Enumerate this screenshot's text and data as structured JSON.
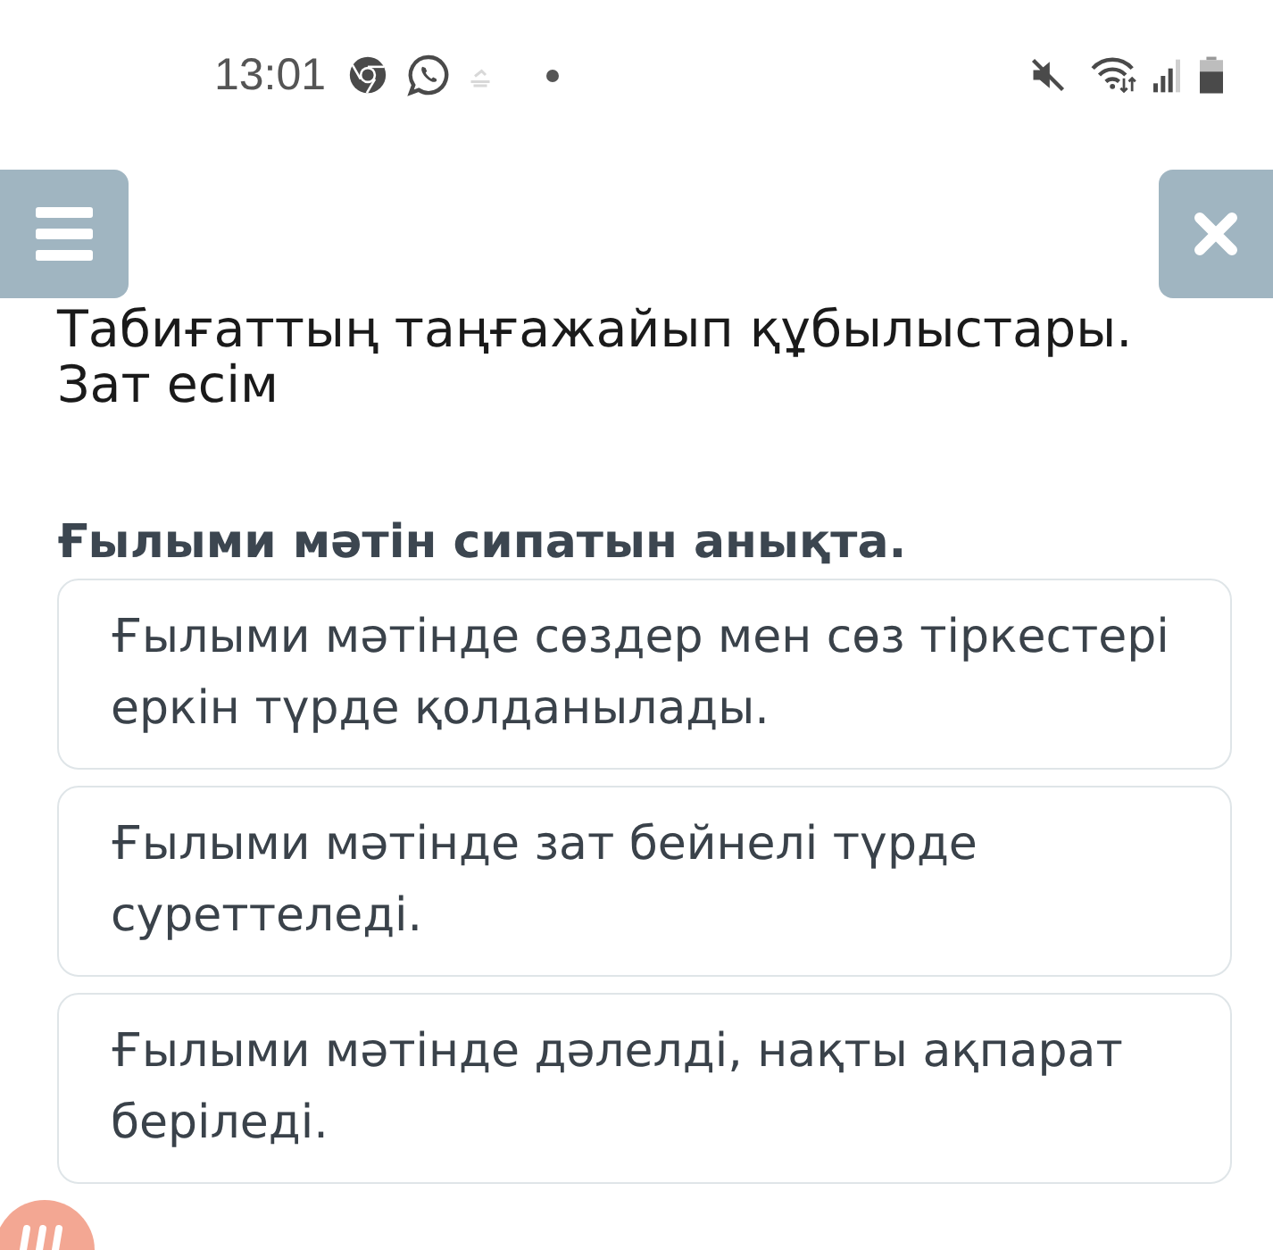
{
  "status_bar": {
    "time": "13:01"
  },
  "lesson": {
    "title": "Табиғаттың таңғажайып құбылыстары. Зат есім"
  },
  "question": {
    "prompt": "Ғылыми мәтін сипатын анықта.",
    "options": [
      {
        "text": "Ғылыми мәтінде сөздер мен сөз тіркестері еркін түрде қолданылады.",
        "selected": false
      },
      {
        "text": "Ғылыми мәтінде зат бейнелі түрде суреттеледі.",
        "selected": false
      },
      {
        "text": "Ғылыми мәтінде дәлелді, нақты ақпарат беріледі.",
        "selected": false
      }
    ]
  }
}
